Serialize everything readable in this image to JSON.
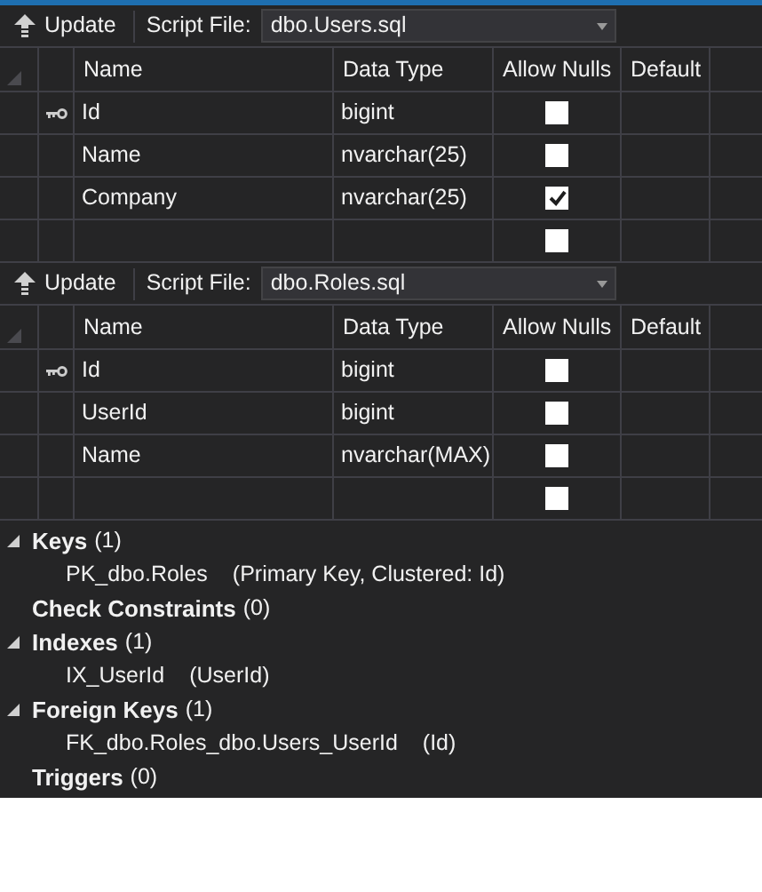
{
  "designers": [
    {
      "toolbar": {
        "update": "Update",
        "script_label": "Script File:",
        "script_file": "dbo.Users.sql"
      },
      "columns": [
        "Name",
        "Data Type",
        "Allow Nulls",
        "Default"
      ],
      "rows": [
        {
          "key": true,
          "name": "Id",
          "data_type": "bigint",
          "allow_nulls": false
        },
        {
          "key": false,
          "name": "Name",
          "data_type": "nvarchar(25)",
          "allow_nulls": false
        },
        {
          "key": false,
          "name": "Company",
          "data_type": "nvarchar(25)",
          "allow_nulls": true
        },
        {
          "key": false,
          "allow_nulls": false
        }
      ]
    },
    {
      "toolbar": {
        "update": "Update",
        "script_label": "Script File:",
        "script_file": "dbo.Roles.sql"
      },
      "columns": [
        "Name",
        "Data Type",
        "Allow Nulls",
        "Default"
      ],
      "rows": [
        {
          "key": true,
          "name": "Id",
          "data_type": "bigint",
          "allow_nulls": false
        },
        {
          "key": false,
          "name": "UserId",
          "data_type": "bigint",
          "allow_nulls": false
        },
        {
          "key": false,
          "name": "Name",
          "data_type": "nvarchar(MAX)",
          "allow_nulls": false
        },
        {
          "key": false,
          "allow_nulls": false
        }
      ]
    }
  ],
  "tree": [
    {
      "title": "Keys",
      "count": "(1)",
      "expanded": true,
      "children": [
        {
          "name": "PK_dbo.Roles",
          "detail": "(Primary Key, Clustered: Id)"
        }
      ]
    },
    {
      "title": "Check Constraints",
      "count": "(0)"
    },
    {
      "title": "Indexes",
      "count": "(1)",
      "expanded": true,
      "children": [
        {
          "name": "IX_UserId",
          "detail": "(UserId)"
        }
      ]
    },
    {
      "title": "Foreign Keys",
      "count": "(1)",
      "expanded": true,
      "children": [
        {
          "name": "FK_dbo.Roles_dbo.Users_UserId",
          "detail": "(Id)"
        }
      ]
    },
    {
      "title": "Triggers",
      "count": "(0)"
    }
  ]
}
